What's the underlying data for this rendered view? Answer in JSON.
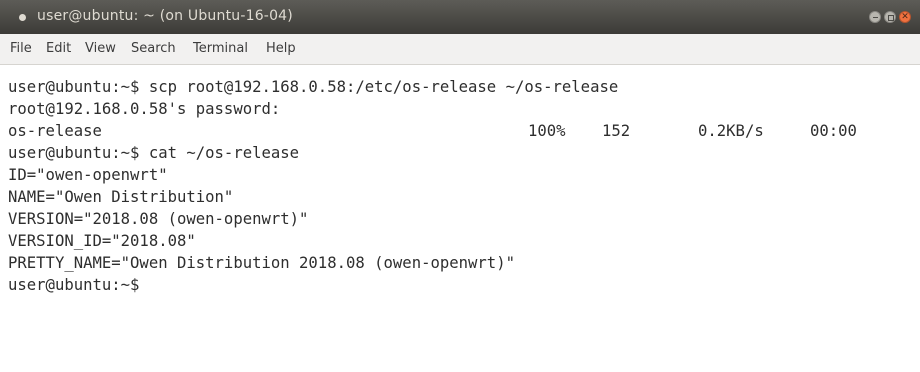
{
  "window": {
    "title": "user@ubuntu: ~ (on Ubuntu-16-04)",
    "accent_close": "#f0713f",
    "titlebar_color": "#3c3b37"
  },
  "menu": {
    "items": [
      "File",
      "Edit",
      "View",
      "Search",
      "Terminal",
      "Help"
    ]
  },
  "terminal": {
    "lines": [
      "user@ubuntu:~$ scp root@192.168.0.58:/etc/os-release ~/os-release",
      "root@192.168.0.58's password:",
      "",
      "user@ubuntu:~$ cat ~/os-release",
      "ID=\"owen-openwrt\"",
      "NAME=\"Owen Distribution\"",
      "VERSION=\"2018.08 (owen-openwrt)\"",
      "VERSION_ID=\"2018.08\"",
      "PRETTY_NAME=\"Owen Distribution 2018.08 (owen-openwrt)\"",
      "user@ubuntu:~$"
    ],
    "transfer": {
      "file": "os-release",
      "percent": "100%",
      "size": "152",
      "rate": "0.2KB/s",
      "eta": "00:00"
    }
  }
}
